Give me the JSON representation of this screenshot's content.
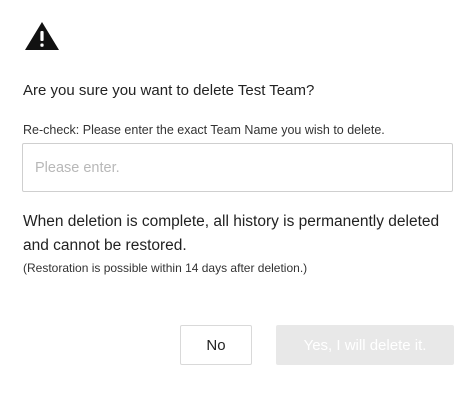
{
  "dialog": {
    "icon": "warning-triangle-icon",
    "question": "Are you sure you want to delete Test Team?",
    "recheck_label": "Re-check: Please enter the exact Team Name you wish to delete.",
    "input": {
      "placeholder": "Please enter.",
      "value": ""
    },
    "warning": "When deletion is complete, all history is permanently deleted and cannot be restored.",
    "restore_note": "(Restoration is possible within 14 days after deletion.)",
    "buttons": {
      "no_label": "No",
      "yes_label": "Yes, I will delete it.",
      "yes_disabled": true
    }
  }
}
